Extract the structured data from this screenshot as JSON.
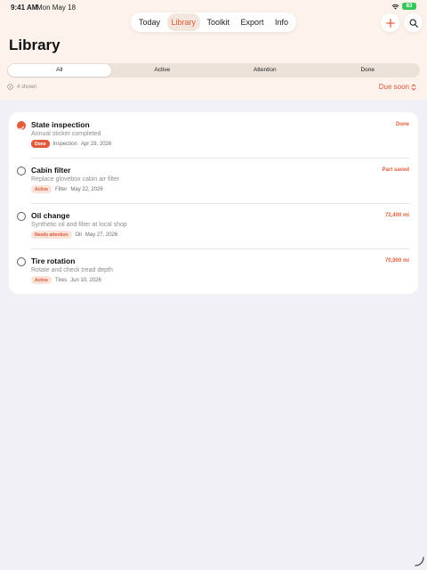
{
  "status_bar": {
    "time": "9:41 AM",
    "date": "Mon May 18",
    "battery": "83"
  },
  "tabs": [
    {
      "label": "Today"
    },
    {
      "label": "Library"
    },
    {
      "label": "Toolkit"
    },
    {
      "label": "Export"
    },
    {
      "label": "Info"
    }
  ],
  "active_tab": "Library",
  "page": {
    "title": "Library"
  },
  "filters": {
    "options": [
      {
        "label": "All"
      },
      {
        "label": "Active"
      },
      {
        "label": "Attention"
      },
      {
        "label": "Done"
      }
    ],
    "selected": "All"
  },
  "list_meta": {
    "count_label": "4 shown",
    "sort_label": "Due soon"
  },
  "items": [
    {
      "title": "State inspection",
      "subtitle": "Annual sticker completed",
      "badge": "Done",
      "category": "Inspection",
      "date": "Apr 29, 2026",
      "right": "Done",
      "completed": true
    },
    {
      "title": "Cabin filter",
      "subtitle": "Replace glovebox cabin air filter",
      "badge": "Active",
      "category": "Filter",
      "date": "May 22, 2026",
      "right": "Part saved",
      "completed": false
    },
    {
      "title": "Oil change",
      "subtitle": "Synthetic oil and filter at local shop",
      "badge": "Needs attention",
      "category": "Oil",
      "date": "May 27, 2026",
      "right": "72,400 mi",
      "completed": false
    },
    {
      "title": "Tire rotation",
      "subtitle": "Rotate and check tread depth",
      "badge": "Active",
      "category": "Tires",
      "date": "Jun 10, 2026",
      "right": "70,900 mi",
      "completed": false
    }
  ],
  "colors": {
    "accent": "#d9573a",
    "header_background": "#fdf3ec",
    "page_background": "#f1f0f6",
    "done_badge": "#e05b3c",
    "soft_badge": "#fbe3d9",
    "battery": "#35c759"
  },
  "icons": {
    "add": "plus-icon",
    "search": "search-icon",
    "count": "list-count-icon",
    "sort": "chevron-up-down-icon",
    "check": "checkmark-icon",
    "wifi": "wifi-icon",
    "battery": "battery-icon"
  }
}
